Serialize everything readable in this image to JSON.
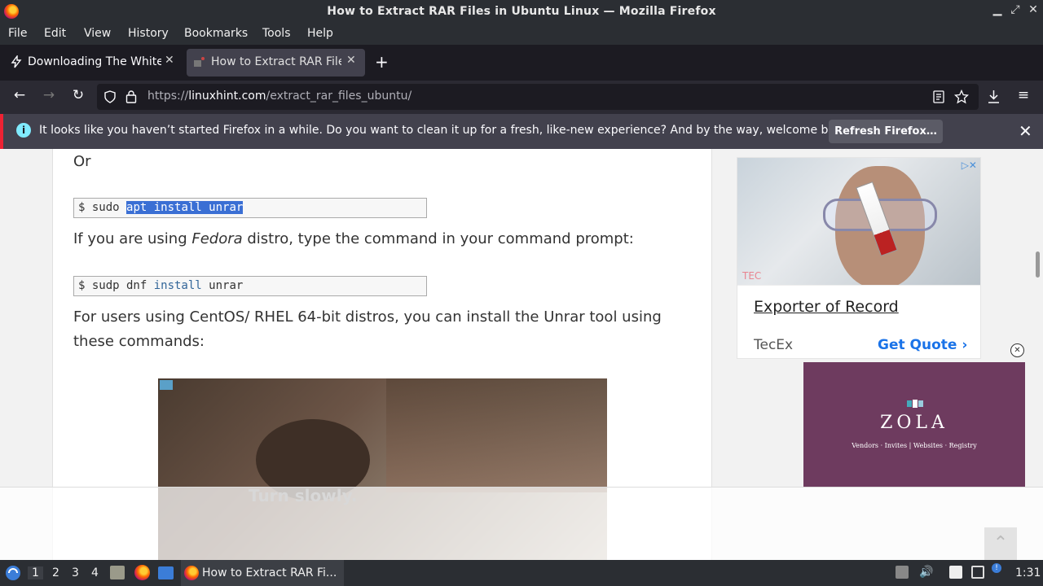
{
  "window": {
    "title": "How to Extract RAR Files in Ubuntu Linux — Mozilla Firefox"
  },
  "menu": {
    "items": [
      "File",
      "Edit",
      "View",
      "History",
      "Bookmarks",
      "Tools",
      "Help"
    ]
  },
  "tabs": [
    {
      "label": "Downloading The White H"
    },
    {
      "label": "How to Extract RAR Files"
    }
  ],
  "url": {
    "prefix": "https://",
    "domain": "linuxhint.com",
    "path": "/extract_rar_files_ubuntu/"
  },
  "notification": {
    "message": "It looks like you haven’t started Firefox in a while. Do you want to clean it up for a fresh, like-new experience? And by the way, welcome back!",
    "button": "Refresh Firefox…"
  },
  "article": {
    "or": "Or",
    "code1": {
      "prompt": "$ sudo ",
      "selected": "apt install unrar"
    },
    "fedora_pre": "If you are using ",
    "fedora_em": "Fedora",
    "fedora_post": " distro, type the command in your command prompt:",
    "code2": {
      "prompt": "$ sudp dnf ",
      "kw": "install",
      "rest": " unrar"
    },
    "centos": "For users using CentOS/ RHEL 64-bit distros, you can install the Unrar tool using these commands:",
    "video_caption": "Turn slowly."
  },
  "ads": {
    "ad1": {
      "headline": "Exporter of Record",
      "brand": "TecEx",
      "cta": "Get Quote",
      "logo": "TEC"
    },
    "ad2": {
      "brand": "ZOLA",
      "tagline": "Vendors · Invites | Websites · Registry"
    }
  },
  "taskbar": {
    "workspaces": [
      "1",
      "2",
      "3",
      "4"
    ],
    "task": "How to Extract RAR Fi...",
    "clock": "1:31"
  }
}
